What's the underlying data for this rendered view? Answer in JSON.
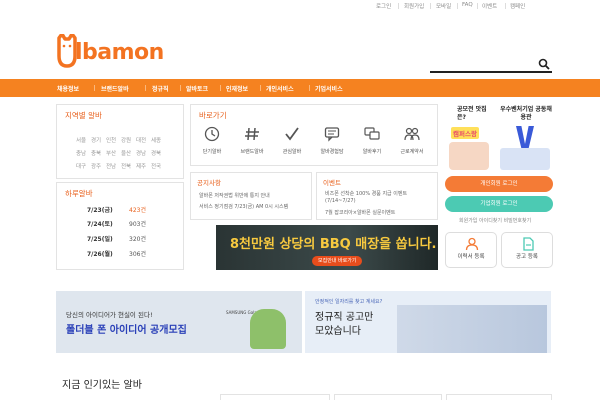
{
  "top_links": [
    "로그인",
    "회원가입",
    "모바일",
    "FAQ",
    "이벤트",
    "캠페인"
  ],
  "logo": {
    "text": "lbamon"
  },
  "search": {
    "placeholder": ""
  },
  "nav": [
    "채용정보",
    "브랜드알바",
    "정규직",
    "알바토크",
    "인재정보",
    "개인서비스",
    "기업서비스"
  ],
  "regions": {
    "title": "지역별 알바",
    "rows": [
      [
        "서울",
        "경기",
        "인천",
        "강원",
        "대전",
        "세종"
      ],
      [
        "충남",
        "충북",
        "부산",
        "울산",
        "경남",
        "경북"
      ],
      [
        "대구",
        "광주",
        "전남",
        "전북",
        "제주",
        "전국"
      ]
    ]
  },
  "daily": {
    "title": "하루알바",
    "rows": [
      {
        "date": "7/23(금)",
        "count": "423건"
      },
      {
        "date": "7/24(토)",
        "count": "903건"
      },
      {
        "date": "7/25(일)",
        "count": "320건"
      },
      {
        "date": "7/26(월)",
        "count": "306건"
      }
    ]
  },
  "shortcuts": {
    "title": "바로가기",
    "items": [
      "단기알바",
      "브랜드알바",
      "관심알바",
      "알바경험담",
      "알바후기",
      "근로계약서"
    ]
  },
  "notice": {
    "title": "공지사항",
    "items": [
      "알바몬 저작권법 위반에 통지 안내",
      "서비스 정기점검 7/23(금) AM 0시 시스템"
    ]
  },
  "event": {
    "title": "이벤트",
    "items": [
      "비즈폰 선착순 100% 경품 지급 이벤트 (7/14~7/27)",
      "7월 잡코리아×알바몬 실문이벤트"
    ]
  },
  "banner_mid": {
    "text": "8천만원 상당의 BBQ 매장을 쏩니다.",
    "button": "모집안내 바로가기"
  },
  "ads": {
    "left_top": "공모전 맛집은?",
    "left_name": "캠퍼스랑",
    "right_top": "우수벤처기업 공동채용관"
  },
  "login": {
    "personal": "개인회원 로그인",
    "corporate": "기업회원 로그인",
    "links": "회원가입  아이디찾기  비밀번호찾기"
  },
  "side_boxes": [
    "이력서 등록",
    "공고 등록"
  ],
  "banner_bottom_left": {
    "line1": "당신의 아이디어가 현실이 된다!",
    "line2": "폴더블 폰 아이디어 공개모집",
    "brand": "SAMSUNG Galaxy"
  },
  "banner_bottom_right": {
    "line0": "안정적인 일자리를 찾고 계세요?",
    "line1": "정규직 공고만",
    "line2": "모았습니다"
  },
  "popular": {
    "title": "지금 인기있는 알바"
  },
  "colors": {
    "accent": "#f58220",
    "text_accent": "#e8601c",
    "login_personal": "#f47b36",
    "login_corporate": "#4ccab3"
  }
}
